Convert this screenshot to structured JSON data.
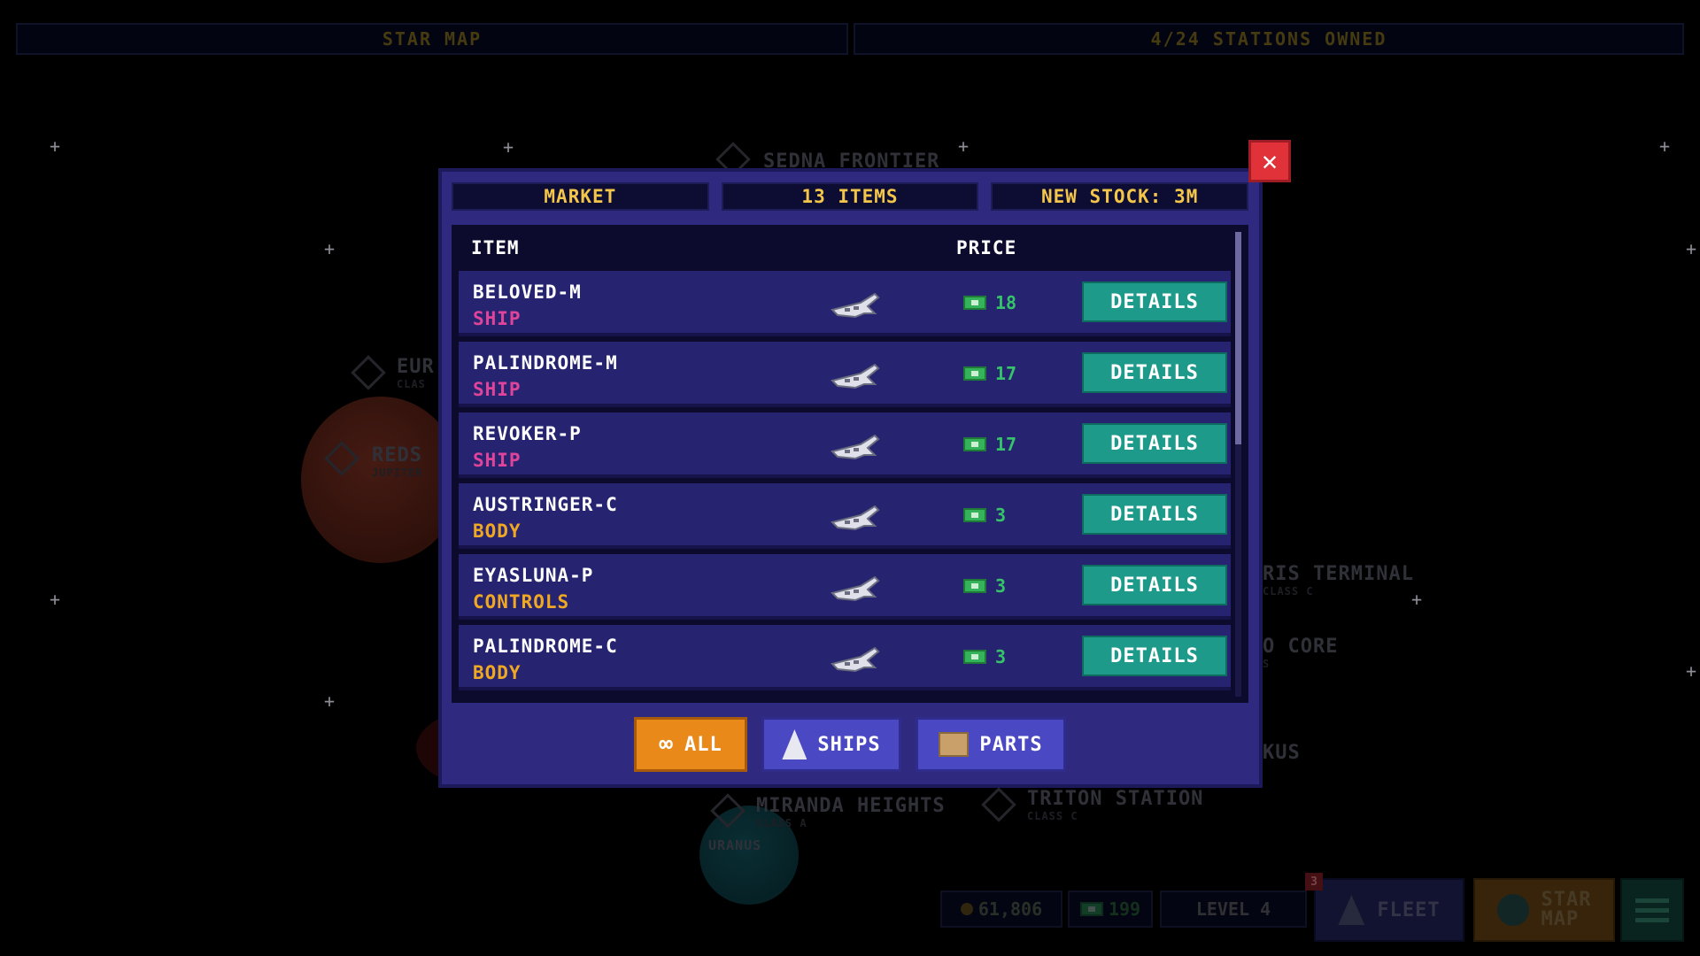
{
  "top_bar": {
    "left_label": "STAR MAP",
    "right_label": "4/24 STATIONS OWNED"
  },
  "map": {
    "locations": [
      {
        "name": "SEDNA FRONTIER",
        "class": ""
      },
      {
        "name": "EUR",
        "class": "CLAS"
      },
      {
        "name": "REDS",
        "class": "JUPITER"
      },
      {
        "name": "RIS TERMINAL",
        "class": "CLASS C"
      },
      {
        "name": "O CORE",
        "class": "S"
      },
      {
        "name": "KUS",
        "class": ""
      },
      {
        "name": "MIRANDA HEIGHTS",
        "class": "CLASS A"
      },
      {
        "name": "TRITON STATION",
        "class": "CLASS C"
      }
    ],
    "planet_label": "URANUS"
  },
  "market": {
    "title": "MARKET",
    "items_count": "13 ITEMS",
    "new_stock": "NEW STOCK: 3M",
    "close_icon": "close-icon",
    "columns": {
      "item": "ITEM",
      "price": "PRICE"
    },
    "rows": [
      {
        "name": "BELOVED-M",
        "category": "SHIP",
        "price": "18",
        "action": "DETAILS",
        "cat_color": "#e0449a"
      },
      {
        "name": "PALINDROME-M",
        "category": "SHIP",
        "price": "17",
        "action": "DETAILS",
        "cat_color": "#e0449a"
      },
      {
        "name": "REVOKER-P",
        "category": "SHIP",
        "price": "17",
        "action": "DETAILS",
        "cat_color": "#e0449a"
      },
      {
        "name": "AUSTRINGER-C",
        "category": "BODY",
        "price": "3",
        "action": "DETAILS",
        "cat_color": "#f0a824"
      },
      {
        "name": "EYASLUNA-P",
        "category": "CONTROLS",
        "price": "3",
        "action": "DETAILS",
        "cat_color": "#f0a824"
      },
      {
        "name": "PALINDROME-C",
        "category": "BODY",
        "price": "3",
        "action": "DETAILS",
        "cat_color": "#f0a824"
      }
    ],
    "filters": {
      "all": "ALL",
      "ships": "SHIPS",
      "parts": "PARTS",
      "active": "all"
    }
  },
  "hud": {
    "coins": "61,806",
    "cash": "199",
    "level": "LEVEL 4",
    "fleet_label": "FLEET",
    "fleet_badge": "3",
    "star_map_line1": "STAR",
    "star_map_line2": "MAP"
  },
  "colors": {
    "modal_bg": "#2f2a80",
    "details_button": "#1d9a8a",
    "active_filter": "#e8891a",
    "filter_button": "#4b48c4",
    "price_green": "#36c46a",
    "tab_text": "#f3c64a"
  }
}
